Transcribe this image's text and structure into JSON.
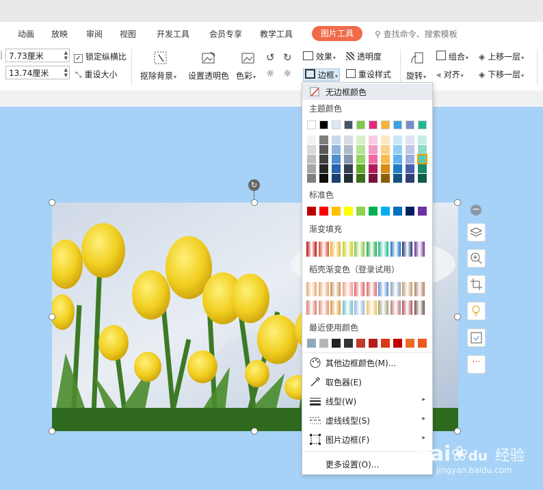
{
  "tabs": [
    "动画",
    "放映",
    "审阅",
    "视图",
    "开发工具",
    "会员专享",
    "教学工具"
  ],
  "active_tab": "图片工具",
  "search": {
    "placeholder": "查找命令、搜索模板"
  },
  "size": {
    "width": "7.73厘米",
    "height": "13.74厘米"
  },
  "ribbon": {
    "lock_ratio": "锁定纵横比",
    "reset_size": "重设大小",
    "remove_bg": "抠除背景",
    "set_transparent": "设置透明色",
    "color": "色彩",
    "effects": "效果",
    "transparency": "透明度",
    "border": "边框",
    "reset_style": "重设样式",
    "rotate": "旋转",
    "group": "组合",
    "align": "对齐",
    "bring_forward": "上移一层",
    "send_backward": "下移一层"
  },
  "menu": {
    "no_border": "无边框颜色",
    "theme_colors": "主题颜色",
    "standard_colors": "标准色",
    "gradient_fill": "渐变填充",
    "gradient_trial": "稻壳渐变色（登录试用）",
    "recent_colors": "最近使用颜色",
    "items": [
      {
        "label": "其他边框颜色(M)...",
        "submenu": false,
        "icon": "palette-icon"
      },
      {
        "label": "取色器(E)",
        "submenu": false,
        "icon": "eyedropper-icon"
      },
      {
        "label": "线型(W)",
        "submenu": true,
        "icon": "line-style-icon"
      },
      {
        "label": "虚线线型(S)",
        "submenu": true,
        "icon": "dash-style-icon"
      },
      {
        "label": "图片边框(F)",
        "submenu": true,
        "icon": "picture-border-icon"
      }
    ],
    "more": "更多设置(O)..."
  },
  "colors": {
    "theme_top": [
      "#ffffff",
      "#000000",
      "#dce9f5",
      "#44546a",
      "#7ec94a",
      "#e0297b",
      "#f9b233",
      "#3aa1e0",
      "#7a8cc8",
      "#21b893"
    ],
    "theme_shades": [
      [
        "#f2f2f2",
        "#7f7f7f",
        "#c9d9ec",
        "#d5dce4",
        "#d8f0c8",
        "#f9cde0",
        "#fde8c4",
        "#c8e6f8",
        "#dfe3f3",
        "#c4eee4"
      ],
      [
        "#d9d9d9",
        "#595959",
        "#8cb3dc",
        "#adb9ca",
        "#b5e296",
        "#f39bc1",
        "#fbd18a",
        "#93cdf2",
        "#bec7e7",
        "#8fdcc9"
      ],
      [
        "#bfbfbf",
        "#404040",
        "#4f8fcd",
        "#8496b0",
        "#93d465",
        "#ed6aa2",
        "#f9bb50",
        "#5eb4ec",
        "#9eabdb",
        "#5ccbaf"
      ],
      [
        "#a6a6a6",
        "#262626",
        "#2564a8",
        "#333f50",
        "#5ea62a",
        "#b21a5a",
        "#d68d10",
        "#1f7dbf",
        "#4a5fab",
        "#178a6d"
      ],
      [
        "#7f7f7f",
        "#0d0d0d",
        "#1a4370",
        "#222a35",
        "#3e6e1c",
        "#77113c",
        "#8f5e0b",
        "#14537f",
        "#313f72",
        "#0f5c48"
      ]
    ],
    "standard": [
      "#c00000",
      "#ff0000",
      "#ffc000",
      "#ffff00",
      "#92d050",
      "#00b050",
      "#00b0f0",
      "#0070c0",
      "#002060",
      "#7030a0"
    ],
    "gradient": [
      "#b80d0d",
      "#e04a2a",
      "#e6b02a",
      "#c8cc1c",
      "#7fc63a",
      "#22a84a",
      "#1bb58c",
      "#1a6fc0",
      "#16366f",
      "#6a2c93"
    ],
    "trial_row1": [
      "#e6a96e",
      "#e8a46e",
      "#c09252",
      "#f19a8a",
      "#de5f6a",
      "#d86a6a",
      "#5b8fd0",
      "#8aa3b8",
      "#c19a6e",
      "#b07a60"
    ],
    "trial_row2": [
      "#d87a6e",
      "#e08c70",
      "#d69a3c",
      "#6bbcca",
      "#8ab4dc",
      "#f0c060",
      "#9aa070",
      "#b8777a",
      "#b05060",
      "#6a5040"
    ],
    "recent": [
      "#8fa9bc",
      "#b5b5b5",
      "#222222",
      "#333333",
      "#c0392b",
      "#b71c1c",
      "#d93a1a",
      "#c00000",
      "#ec6b26",
      "#ee5a1f"
    ],
    "accent": "#f06a4a"
  },
  "watermark": {
    "brand": "Bai",
    "brand2": "经验",
    "url": "jingyan.baidu.com"
  }
}
